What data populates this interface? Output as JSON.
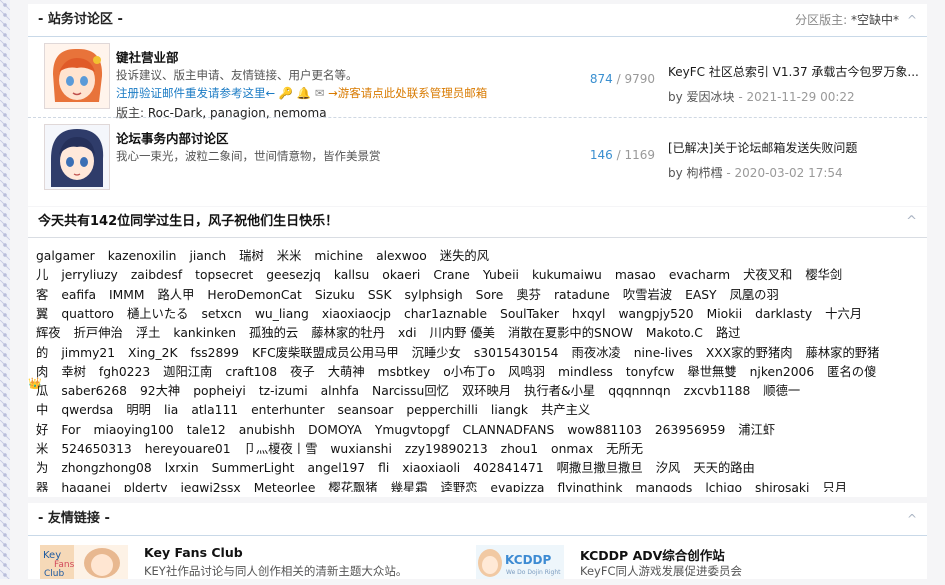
{
  "forum_section": {
    "title": "- 站务讨论区 -",
    "moderator_label": "分区版主:",
    "moderator_value": "*空缺中*",
    "toggle": "^",
    "forums": [
      {
        "title": "键社营业部",
        "desc": "投诉建议、版主申请、友情链接、用户更名等。",
        "notice_blue": "注册验证邮件重发请参考这里←",
        "notice_orange": "→游客请点此处联系管理员邮箱",
        "mods_label": "版主:",
        "mods": "Roc-Dark, panagion, nemoma",
        "topics": "874",
        "posts": " / 9790",
        "last_title": "KeyFC 社区总索引 V1.37 承载古今包罗万象...",
        "last_by_label": "by",
        "last_user": "爱因冰块",
        "last_time": "- 2021-11-29 00:22"
      },
      {
        "title": "论坛事务内部讨论区",
        "desc": "我心一束光，波粒二象间，世间情意物，皆作美景赏",
        "topics": "146",
        "posts": " / 1169",
        "last_title": "[已解决]关于论坛邮箱发送失败问题",
        "last_by_label": "by",
        "last_user": "枸栉樰",
        "last_time": "- 2020-03-02 17:54"
      }
    ]
  },
  "birthday": {
    "title": "今天共有142位同学过生日，风子祝他们生日快乐！",
    "toggle": "^",
    "rows": [
      [
        "galgamer",
        "kazenoxilin",
        "jianch",
        "瑞树",
        "米米",
        "michine",
        "alexwoo",
        "迷失的风"
      ],
      [
        "儿",
        "jerryliuzy",
        "zaibdesf",
        "topsecret",
        "geesezjq",
        "kallsu",
        "okaeri",
        "Crane",
        "Yubeii",
        "kukumaiwu",
        "masao",
        "evacharm",
        "犬夜叉和",
        "樱华剑"
      ],
      [
        "客",
        "eafifa",
        "IMMM",
        "路人甲",
        "HeroDemonCat",
        "Sizuku",
        "SSK",
        "sylphsigh",
        "Sore",
        "奥芬",
        "ratadune",
        "吹雪岩波",
        "EASY",
        "凤凰の羽"
      ],
      [
        "翼",
        "quattoro",
        "樋上いたる",
        "setxcn",
        "wu_liang",
        "xiaoxiaocjp",
        "char1aznable",
        "SoulTaker",
        "hxqyl",
        "wangpjy520",
        "Miokii",
        "darklasty",
        "十六月"
      ],
      [
        "辉夜",
        "折戸伸治",
        "浮土",
        "kankinken",
        "孤独的云",
        "藤林家的牡丹",
        "xdi",
        "川内野 優美",
        "消散在夏影中的SNOW",
        "Makoto.C",
        "路过"
      ],
      [
        "的",
        "jimmy21",
        "Xing_2K",
        "fss2899",
        "KFC废柴联盟成员公用马甲",
        "沉睡少女",
        "s3015430154",
        "雨夜冰凌",
        "nine-lives",
        "XXX家的野猪肉",
        "藤林家的野猪"
      ],
      [
        "肉",
        "幸树",
        "fgh0223",
        "迦阳江南",
        "craft108",
        "夜子",
        "大萌神",
        "msbtkey",
        "o小布丁o",
        "风鸣羽",
        "mindless",
        "tonyfcw",
        "舉世無雙",
        "njken2006",
        "匿名の傻"
      ],
      [
        "瓜",
        "saber6268",
        "92大神",
        "popheiyi",
        "tz-izumi",
        "alnhfa",
        "Narcissu回忆",
        "双环映月",
        "执行者&小星",
        "qqqnnnqn",
        "zxcvb1188",
        "顺德一"
      ],
      [
        "中",
        "qwerdsa",
        "明明",
        "lia",
        "atla111",
        "enterhunter",
        "seansoar",
        "pepperchilli",
        "liangk",
        "共产主义"
      ],
      [
        "好",
        "For",
        "miaoying100",
        "tale12",
        "anubishh",
        "DOMOYA",
        "Ymugvtopgf",
        "CLANNADFANS",
        "wow881103",
        "263956959",
        "浦江虾"
      ],
      [
        "米",
        "524650313",
        "hereyouare01",
        "卩灬榎夜丨雪",
        "wuxianshi",
        "zzy19890213",
        "zhou1",
        "onmax",
        "无所无"
      ],
      [
        "为",
        "zhongzhong08",
        "lxrxin",
        "SummerLight",
        "angel197",
        "fli",
        "xiaoxiaoli",
        "402841471",
        "啊撒旦撒旦撒旦",
        "汐风",
        "天天的路由"
      ],
      [
        "器",
        "haganei",
        "plderty",
        "ieqwj2ssx",
        "Meteorlee",
        "樱花飘猪",
        "幾星霜",
        "逵野恋",
        "evapizza",
        "flyingthink",
        "mangods",
        "lchigo",
        "shirosaki",
        "只月"
      ]
    ]
  },
  "links_section": {
    "title": "- 友情链接 -",
    "toggle": "^",
    "links": [
      {
        "name": "Key Fans Club",
        "desc": "KEY社作品讨论与同人创作相关的清新主题大众站。",
        "logo_text": "Key Fans Club"
      },
      {
        "name": "KCDDP ADV综合创作站",
        "desc": "KeyFC同人游戏发展促进委员会",
        "logo_text": "KCDDP"
      }
    ]
  },
  "icons": [
    "key-icon",
    "bell-icon",
    "mail-icon",
    "crown-icon",
    "collapse-icon"
  ]
}
